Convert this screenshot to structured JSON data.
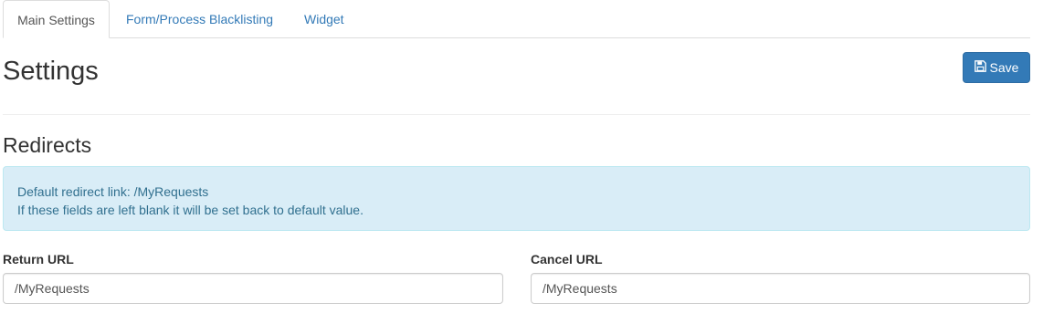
{
  "tabs": [
    {
      "label": "Main Settings"
    },
    {
      "label": "Form/Process Blacklisting"
    },
    {
      "label": "Widget"
    }
  ],
  "page": {
    "title": "Settings",
    "save_label": "Save"
  },
  "redirects": {
    "title": "Redirects",
    "alert_line1": "Default redirect link: /MyRequests",
    "alert_line2": "If these fields are left blank it will be set back to default value.",
    "return_label": "Return URL",
    "return_value": "/MyRequests",
    "cancel_label": "Cancel URL",
    "cancel_value": "/MyRequests"
  },
  "colors": {
    "primary": "#337ab7",
    "alert_bg": "#d9edf7",
    "alert_text": "#31708f"
  },
  "icons": {
    "save": "floppy-disk-icon"
  }
}
